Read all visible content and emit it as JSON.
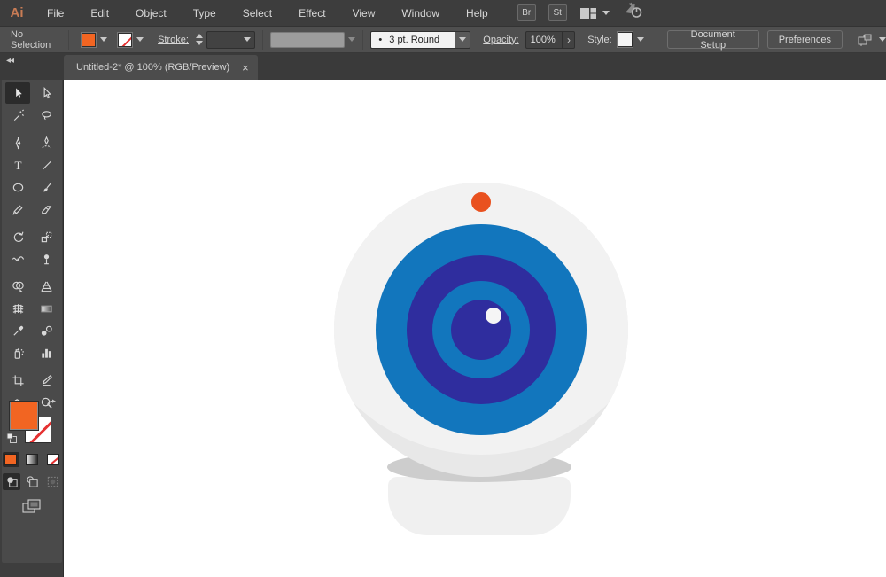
{
  "app": {
    "logo_text": "Ai"
  },
  "menu_bar": {
    "items": [
      "File",
      "Edit",
      "Object",
      "Type",
      "Select",
      "Effect",
      "View",
      "Window",
      "Help"
    ],
    "bridge_label": "Br",
    "stock_label": "St"
  },
  "control_bar": {
    "selection_status": "No Selection",
    "stroke_label": "Stroke:",
    "brush_bullet": "•",
    "brush_value": "3 pt. Round",
    "opacity_label": "Opacity:",
    "opacity_value": "100%",
    "opacity_arrow": "›",
    "style_label": "Style:",
    "document_setup_label": "Document Setup",
    "preferences_label": "Preferences"
  },
  "document_tab": {
    "title": "Untitled-2* @ 100% (RGB/Preview)",
    "close_glyph": "×"
  },
  "tool_panel": {
    "collapse_glyph": "◂◂",
    "active_tool": "selection",
    "tools": [
      "selection",
      "direct-selection",
      "magic-wand",
      "lasso",
      "pen",
      "curvature",
      "type",
      "line-segment",
      "ellipse",
      "paintbrush",
      "shaper",
      "eraser",
      "rotate",
      "scale",
      "width",
      "puppet-warp",
      "shape-builder",
      "perspective-grid",
      "mesh",
      "gradient",
      "eyedropper",
      "blend",
      "symbol-sprayer",
      "column-graph",
      "artboard",
      "slice",
      "hand",
      "zoom"
    ],
    "fill_color": "#F26522",
    "stroke_setting": "none",
    "drawing_mode": "draw-normal"
  },
  "canvas": {
    "artwork_name": "webcam-illustration",
    "colors": {
      "sphere": "#F2F2F2",
      "sphere_shadow": "#E8E8E8",
      "base": "#F0F0F0",
      "base_band": "#CDCDCD",
      "lens_blue": "#1276BD",
      "lens_indigo": "#2F2D9E",
      "led_orange": "#E9511F",
      "highlight": "#F5F5F5"
    }
  }
}
